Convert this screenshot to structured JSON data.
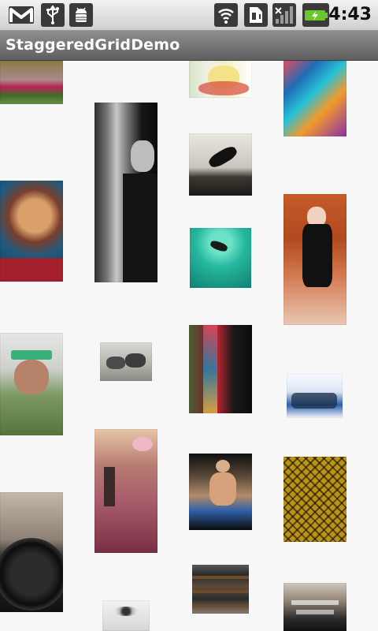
{
  "status_bar": {
    "time": "4:43",
    "icons": [
      "gmail-icon",
      "usb-icon",
      "android-debug-icon",
      "wifi-icon",
      "sim-icon",
      "signal-icon",
      "battery-charging-icon"
    ]
  },
  "app": {
    "title": "StaggeredGridDemo"
  },
  "grid": {
    "photos": [
      {
        "name": "photo-tile-1"
      },
      {
        "name": "photo-tile-2"
      },
      {
        "name": "photo-tile-3"
      },
      {
        "name": "photo-tile-4"
      },
      {
        "name": "photo-tile-5"
      },
      {
        "name": "photo-tile-6"
      },
      {
        "name": "photo-tile-7"
      },
      {
        "name": "photo-tile-8"
      },
      {
        "name": "photo-tile-9"
      },
      {
        "name": "photo-tile-10"
      },
      {
        "name": "photo-tile-11"
      },
      {
        "name": "photo-tile-12"
      },
      {
        "name": "photo-tile-13"
      },
      {
        "name": "photo-tile-14"
      },
      {
        "name": "photo-tile-15"
      },
      {
        "name": "photo-tile-16"
      },
      {
        "name": "photo-tile-17"
      },
      {
        "name": "photo-tile-18"
      },
      {
        "name": "photo-tile-19"
      },
      {
        "name": "photo-tile-20"
      },
      {
        "name": "photo-tile-21"
      }
    ]
  }
}
